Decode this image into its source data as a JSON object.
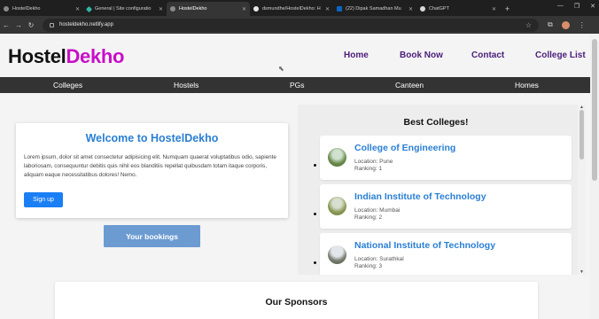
{
  "browser": {
    "tabs": [
      {
        "title": "HostelDekho",
        "icon": "globe-icon",
        "active": false
      },
      {
        "title": "General | Site configuratio",
        "icon": "netlify-icon",
        "active": false
      },
      {
        "title": "HostelDekho",
        "icon": "globe-icon",
        "active": true
      },
      {
        "title": "dsmundhe/HostelDekho: H",
        "icon": "github-icon",
        "active": false
      },
      {
        "title": "(22) Dipak Samadhan Mu",
        "icon": "linkedin-icon",
        "active": false
      },
      {
        "title": "ChatGPT",
        "icon": "chatgpt-icon",
        "active": false
      }
    ],
    "url": "hosteldekho.netlify.app"
  },
  "site": {
    "logo_part1": "Hostel",
    "logo_part2": "Dekho",
    "nav": [
      "Home",
      "Book Now",
      "Contact",
      "College List"
    ],
    "categories": [
      "Colleges",
      "Hostels",
      "PGs",
      "Canteen",
      "Homes"
    ]
  },
  "welcome": {
    "title": "Welcome to HostelDekho",
    "text": "Lorem ipsum, dolor sit amet consectetur adipisicing elit. Numquam quaerat voluptatibus odio, sapiente laboriosam, consequuntur debitis quis nihil eos blanditiis repellat quibusdam totam itaque corporis, aliquam eaque necessitatibus dolores! Nemo.",
    "signup_label": "Sign up"
  },
  "bookings_label": "Your bookings",
  "best_colleges": {
    "title": "Best Colleges!",
    "items": [
      {
        "name": "College of Engineering",
        "location": "Location: Pune",
        "ranking": "Ranking: 1"
      },
      {
        "name": "Indian Institute of Technology",
        "location": "Location: Mumbai",
        "ranking": "Ranking: 2"
      },
      {
        "name": "National Institute of Technology",
        "location": "Location: Surathkal",
        "ranking": "Ranking: 3"
      }
    ]
  },
  "sponsors": {
    "title": "Our Sponsors"
  },
  "colors": {
    "brand_dark": "#111111",
    "brand_accent": "#c80fc8",
    "link_blue": "#2a7fd4",
    "nav_purple": "#4b1d7a",
    "button_blue": "#1a7ef5"
  }
}
